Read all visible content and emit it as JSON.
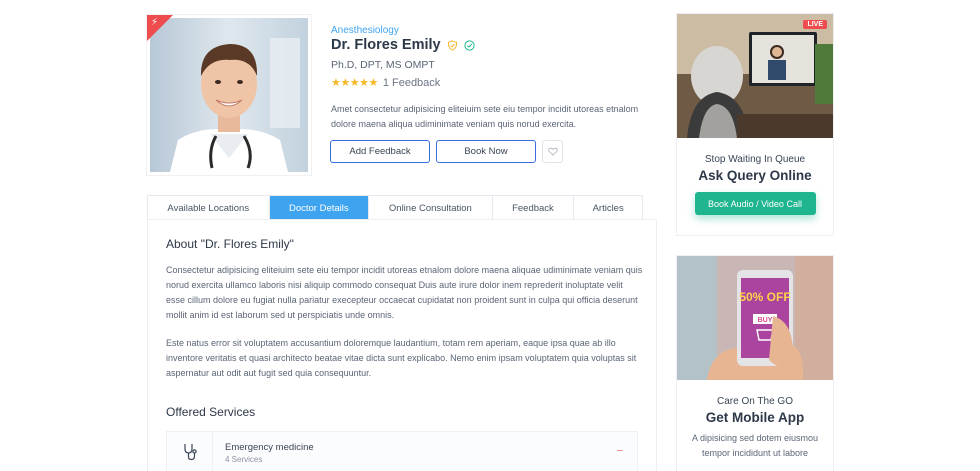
{
  "doctor": {
    "speciality": "Anesthesiology",
    "name": "Dr. Flores Emily",
    "degree": "Ph.D, DPT, MS OMPT",
    "rating_stars": 5,
    "feedback_count": "1 Feedback",
    "description": "Amet consectetur adipisicing eliteiuim sete eiu tempor incidit utoreas etnalom dolore maena aliqua udiminimate veniam quis norud exercita.",
    "badges": [
      "shield-check-icon",
      "check-circle-icon"
    ],
    "featured_icon": "bolt-icon"
  },
  "actions": {
    "add_feedback": "Add Feedback",
    "book_now": "Book Now",
    "favorite_icon": "heart-icon"
  },
  "tabs": [
    {
      "label": "Available Locations",
      "active": false
    },
    {
      "label": "Doctor Details",
      "active": true
    },
    {
      "label": "Online Consultation",
      "active": false
    },
    {
      "label": "Feedback",
      "active": false
    },
    {
      "label": "Articles",
      "active": false
    }
  ],
  "about": {
    "title": "About \"Dr. Flores Emily\"",
    "paragraph_1": "Consectetur adipisicing eliteiuim sete eiu tempor incidit utoreas etnalom dolore maena aliquae udiminimate veniam quis norud exercita ullamco laboris nisi aliquip commodo consequat Duis aute irure dolor inem reprederit inoluptate velit esse cillum dolore eu fugiat nulla pariatur execepteur occaecat cupidatat non proident sunt in culpa qui officia deserunt mollit anim id est laborum sed ut perspiciatis unde omnis.",
    "paragraph_2": "Este natus error sit voluptatem accusantium doloremque laudantium, totam rem aperiam, eaque ipsa quae ab illo inventore veritatis et quasi architecto beatae vitae dicta sunt explicabo. Nemo enim ipsam voluptatem quia voluptas sit aspernatur aut odit aut fugit sed quia consequuntur."
  },
  "services": {
    "title": "Offered Services",
    "items": [
      {
        "name": "Emergency medicine",
        "count": "4 Services",
        "icon": "stethoscope-icon",
        "toggle": "−"
      }
    ]
  },
  "sidebar": {
    "query_card": {
      "badge": "LIVE",
      "subtitle": "Stop Waiting In Queue",
      "heading": "Ask Query Online",
      "button": "Book Audio / Video Call"
    },
    "app_card": {
      "promo": "50% OFF",
      "promo_buy": "BUY",
      "subtitle": "Care On The GO",
      "heading": "Get Mobile App",
      "description": "A dipisicing sed dotem eiusmou tempor incididunt ut labore"
    }
  },
  "colors": {
    "accent_blue": "#3fa4f0",
    "button_border": "#3a6ee0",
    "cta_green": "#1fb58f",
    "live_red": "#ef4d4d",
    "star_gold": "#f6b829"
  }
}
